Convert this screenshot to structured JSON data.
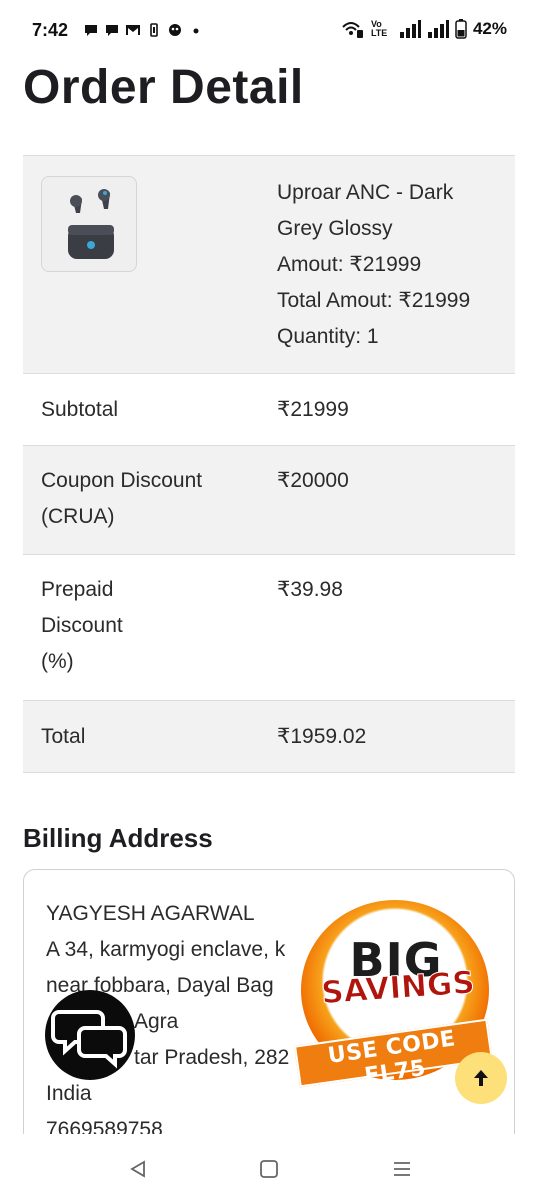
{
  "status_bar": {
    "time": "7:42",
    "battery": "42%",
    "left_icons": [
      "chat-icon",
      "chat-icon",
      "gmail-icon",
      "battery-saver-icon",
      "robot-icon",
      "dot-icon"
    ],
    "right_icons": [
      "wifi-call-icon",
      "volte-icon",
      "signal-icon",
      "signal-icon",
      "battery-icon"
    ],
    "volte_label": "Vo LTE"
  },
  "page": {
    "title": "Order Detail"
  },
  "order": {
    "product": {
      "name_line1": "Uproar ANC - Dark",
      "name_line2": "Grey Glossy",
      "amount": "Amout: ₹21999",
      "total_amount": "Total Amout: ₹21999",
      "quantity": "Quantity: 1",
      "image_icon": "earbuds-icon"
    },
    "subtotal_label": "Subtotal",
    "subtotal_value": "₹21999",
    "coupon_label_line1": "Coupon Discount",
    "coupon_label_line2": "(CRUA)",
    "coupon_value": "₹20000",
    "prepaid_label_line1": "Prepaid",
    "prepaid_label_line2": "Discount",
    "prepaid_label_line3": "(%)",
    "prepaid_value": "₹39.98",
    "total_label": "Total",
    "total_value": "₹1959.02"
  },
  "billing": {
    "title": "Billing Address",
    "lines": [
      "YAGYESH AGARWAL",
      "A 34, karmyogi enclave, k",
      "near fobbara, Dayal Bag",
      "Agra",
      "tar Pradesh, 282",
      "India",
      "7669589758"
    ],
    "line3_prefix": "",
    "line4_suffix": "a",
    "peek": "7669589758"
  },
  "promo": {
    "big": "BIG",
    "savings": "SAVINGS",
    "code": "USE CODE FL75"
  },
  "colors": {
    "accent_orange": "#f07d10",
    "promo_red": "#b0150d",
    "scroll_button": "#fde07a",
    "chat_button": "#0b0b0b"
  }
}
